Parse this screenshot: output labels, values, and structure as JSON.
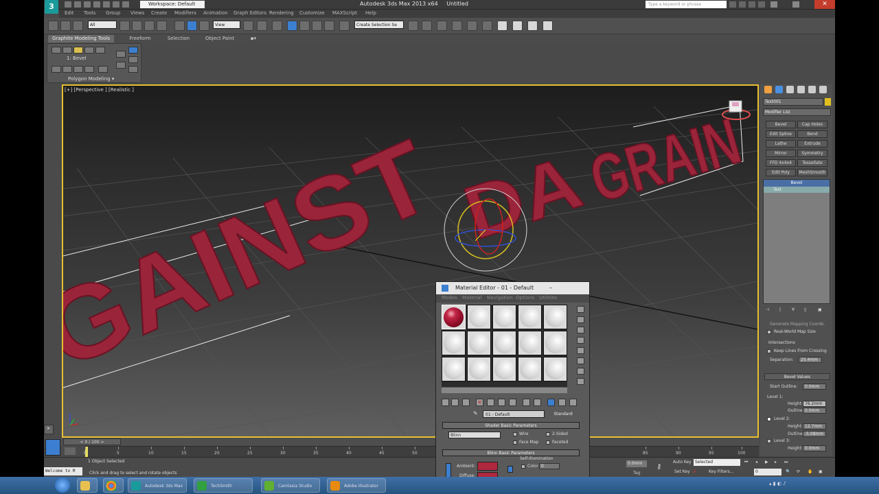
{
  "window": {
    "app_title": "Autodesk 3ds Max  2013 x64",
    "doc_title": "Untitled",
    "workspace": "Workspace: Default",
    "search_placeholder": "Type a keyword or phrase",
    "logo": "3"
  },
  "menubar": [
    "Edit",
    "Tools",
    "Group",
    "Views",
    "Create",
    "Modifiers",
    "Animation",
    "Graph Editors",
    "Rendering",
    "Customize",
    "MAXScript",
    "Help"
  ],
  "toolbar": {
    "filter": "All",
    "view": "View",
    "selection_set": "Create Selection Se"
  },
  "ribbon": {
    "tabs": [
      "Graphite Modeling Tools",
      "Freeform",
      "Selection",
      "Object Paint"
    ],
    "tool_label": "1: Bevel",
    "panel": "Polygon Modeling"
  },
  "viewport": {
    "label": "[+] [Perspective ] [Realistic ]",
    "text_left": "GAINST",
    "text_mid": "DA",
    "text_right": "GRAIN"
  },
  "command_panel": {
    "object_name": "Text001",
    "modifier_list": "Modifier List",
    "modifiers": [
      [
        "Bevel",
        "Cap Holes"
      ],
      [
        "Edit Spline",
        "Bend"
      ],
      [
        "Lathe",
        "Extrude"
      ],
      [
        "Mirror",
        "Symmetry"
      ],
      [
        "FFD 4x4x4",
        "Tessellate"
      ],
      [
        "Edit Poly",
        "MeshSmooth"
      ]
    ],
    "stack": [
      "Bevel",
      "Text"
    ],
    "generate_mapping": "Generate Mapping Coords.",
    "real_world": "Real-World Map Size",
    "intersections": "Intersections",
    "keep_lines": "Keep Lines From Crossing",
    "separation_label": "Separation:",
    "separation_value": "25.4mm",
    "bevel_values": "Bevel Values",
    "start_outline_label": "Start Outline:",
    "start_outline_value": "0.0mm",
    "level1": "Level 1:",
    "height_label": "Height:",
    "outline_label": "Outline:",
    "level1_height": "76.2mm",
    "level1_outline": "0.0mm",
    "level2": "Level 2:",
    "level2_height": "12.7mm",
    "level2_outline": "-5.08mm",
    "level3": "Level 3:",
    "level3_height": "0.0mm"
  },
  "timeline": {
    "frame": "0 / 100",
    "ticks": [
      "0",
      "5",
      "10",
      "15",
      "20",
      "25",
      "30",
      "35",
      "40",
      "45",
      "50",
      "55",
      "60",
      "85",
      "90",
      "95",
      "100"
    ]
  },
  "status": {
    "selected": "1 Object Selected",
    "prompt": "Click and drag to select and rotate objects",
    "maxscript": "Welcome to M",
    "coord_z": "0.0mm",
    "auto_key": "Auto Key",
    "selected_dd": "Selected",
    "set_key": "Set Key",
    "key_filters": "Key Filters...",
    "frame_field": "0",
    "add_tag": "Add Time Tag"
  },
  "material_editor": {
    "title": "Material Editor - 01 - Default",
    "menu": [
      "Modes",
      "Material",
      "Navigation",
      "Options",
      "Utilities"
    ],
    "material_name": "01 - Default",
    "material_type": "Standard",
    "shader_rollout": "Shader Basic Parameters",
    "shader": "Blinn",
    "wire": "Wire",
    "two_sided": "2-Sided",
    "face_map": "Face Map",
    "faceted": "Faceted",
    "blinn_rollout": "Blinn Basic Parameters",
    "self_illum": "Self-Illumination",
    "color": "Color",
    "color_value": "0",
    "ambient": "Ambient:",
    "diffuse": "Diffuse:"
  },
  "taskbar": {
    "items": [
      "",
      "",
      "",
      "Autodesk 3ds Max",
      "TechSmith",
      "Camtasia Studio",
      "Adobe Illustrator"
    ]
  },
  "colors": {
    "text3d": "#9a2439",
    "viewport_border": "#e8c030",
    "accent": "#3c7fd0"
  }
}
